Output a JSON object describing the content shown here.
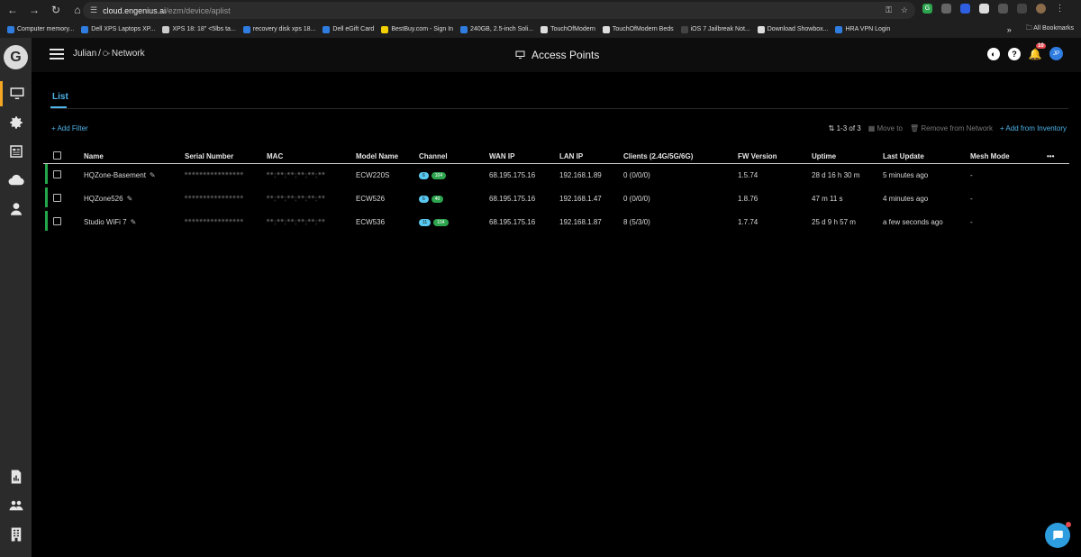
{
  "browser": {
    "url_host": "cloud.engenius.ai",
    "url_path": "/ezm/device/aplist",
    "bookmarks": [
      {
        "label": "Computer memory...",
        "color": "#2f7de1"
      },
      {
        "label": "Dell XPS Laptops XP...",
        "color": "#2f7de1"
      },
      {
        "label": "XPS 18: 18\" <5lbs ta...",
        "color": "#cccccc"
      },
      {
        "label": "recovery disk xps 18...",
        "color": "#2f7de1"
      },
      {
        "label": "Dell eGift Card",
        "color": "#2f7de1"
      },
      {
        "label": "BestBuy.com - Sign In",
        "color": "#f5d000"
      },
      {
        "label": "240GB, 2.5-inch Soli...",
        "color": "#2f7de1"
      },
      {
        "label": "TouchOfModern",
        "color": "#dddddd"
      },
      {
        "label": "TouchOfModern Beds",
        "color": "#dddddd"
      },
      {
        "label": "iOS 7 Jailbreak Not...",
        "color": "#444444"
      },
      {
        "label": "Download Showbox...",
        "color": "#dddddd"
      },
      {
        "label": "HRA VPN Login",
        "color": "#2f7de1"
      }
    ],
    "all_bookmarks": "All Bookmarks",
    "more_bookmarks": "»"
  },
  "header": {
    "breadcrumb_org": "Julian",
    "breadcrumb_sep": "/",
    "breadcrumb_network": "Network",
    "title": "Access Points",
    "notification_count": "10",
    "avatar_initials": "JP"
  },
  "tabs": {
    "list": "List"
  },
  "toolbar": {
    "add_filter": "+ Add Filter",
    "count": "1-3 of 3",
    "move_to": "Move to",
    "remove": "Remove from Network",
    "add_inventory": "+ Add from Inventory"
  },
  "table": {
    "columns": {
      "name": "Name",
      "serial": "Serial Number",
      "mac": "MAC",
      "model": "Model Name",
      "channel": "Channel",
      "wan": "WAN IP",
      "lan": "LAN IP",
      "clients": "Clients (2.4G/5G/6G)",
      "fw": "FW Version",
      "uptime": "Uptime",
      "last_update": "Last Update",
      "mesh": "Mesh Mode",
      "more": "•••"
    },
    "rows": [
      {
        "name": "HQZone-Basement",
        "serial": "****************",
        "mac": "**:**:**:**:**:**",
        "model": "ECW220S",
        "ch1": "6",
        "ch2": "104",
        "wan": "68.195.175.16",
        "lan": "192.168.1.89",
        "clients": "0 (0/0/0)",
        "fw": "1.5.74",
        "uptime": "28 d 16 h 30 m",
        "last_update": "5 minutes ago",
        "mesh": "-"
      },
      {
        "name": "HQZone526",
        "serial": "****************",
        "mac": "**:**:**:**:**:**",
        "model": "ECW526",
        "ch1": "6",
        "ch2": "40",
        "wan": "68.195.175.16",
        "lan": "192.168.1.47",
        "clients": "0 (0/0/0)",
        "fw": "1.8.76",
        "uptime": "47 m 11 s",
        "last_update": "4 minutes ago",
        "mesh": "-"
      },
      {
        "name": "Studio WiFi 7",
        "serial": "****************",
        "mac": "**:**:**:**:**:**",
        "model": "ECW536",
        "ch1": "11",
        "ch2": "104",
        "wan": "68.195.175.16",
        "lan": "192.168.1.87",
        "clients": "8 (5/3/0)",
        "fw": "1.7.74",
        "uptime": "25 d 9 h 57 m",
        "last_update": "a few seconds ago",
        "mesh": "-"
      }
    ]
  },
  "colors": {
    "accent": "#4fb3e8",
    "status_online": "#23a54a",
    "active_nav": "#f5a623"
  }
}
